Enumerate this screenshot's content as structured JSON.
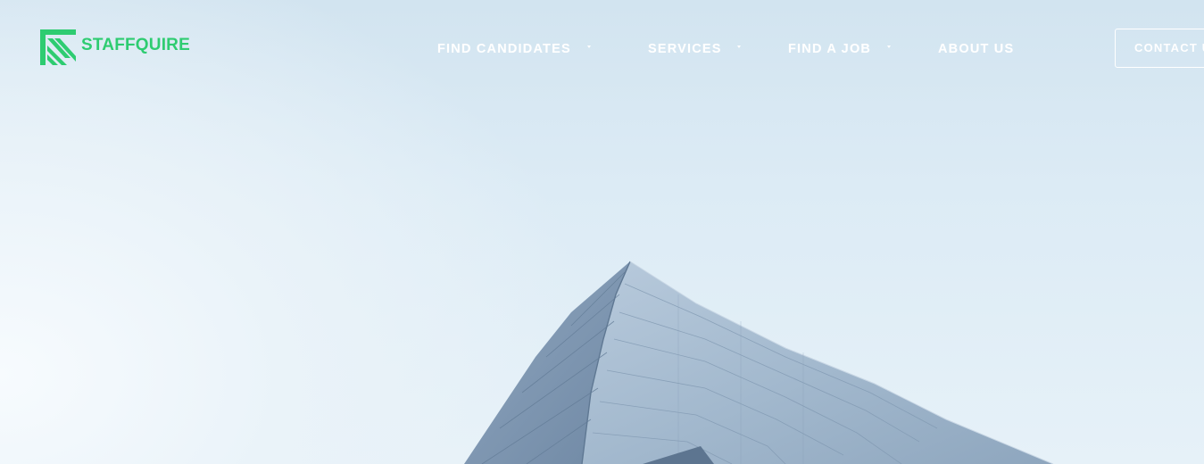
{
  "brand": {
    "name": "STAFFQUIRE",
    "color": "#2ecc71",
    "icon": "chevron-stripes-logo-icon"
  },
  "nav": {
    "items": [
      {
        "label": "FIND CANDIDATES",
        "has_dropdown": true,
        "icon": "caret-down-icon"
      },
      {
        "label": "SERVICES",
        "has_dropdown": true,
        "icon": "caret-down-icon"
      },
      {
        "label": "FIND A JOB",
        "has_dropdown": true,
        "icon": "caret-down-icon"
      },
      {
        "label": "ABOUT US",
        "has_dropdown": false
      }
    ],
    "cta_label": "CONTACT US"
  },
  "hero": {
    "background": "sky-and-glass-building-photo",
    "sky_color": "#dceaf4"
  }
}
